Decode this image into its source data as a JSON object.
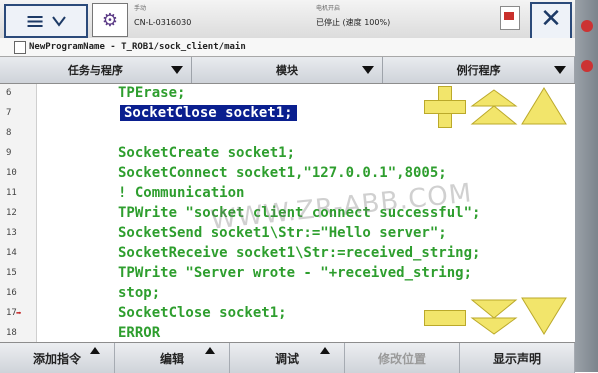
{
  "header": {
    "menu_icon": "hamburger-menu-icon",
    "robot_icon": "robot-status-icon",
    "mode_label": "手动",
    "controller_name": "CN-L-0316030",
    "motors_label": "电机开启",
    "status_text": "已停止 (速度 100%)",
    "close_icon": "close-icon"
  },
  "path": "NewProgramName - T_ROB1/sock_client/main",
  "tabs": [
    {
      "label": "任务与程序"
    },
    {
      "label": "模块"
    },
    {
      "label": "例行程序"
    }
  ],
  "code_lines": [
    {
      "num": "6",
      "text": "TPErase;"
    },
    {
      "num": "7",
      "text": "SocketClose socket1;"
    },
    {
      "num": "8",
      "text": ""
    },
    {
      "num": "9",
      "text": "SocketCreate socket1;"
    },
    {
      "num": "10",
      "text": "SocketConnect socket1,\"127.0.0.1\",8005;"
    },
    {
      "num": "11",
      "text": "! Communication"
    },
    {
      "num": "12",
      "text": "TPWrite \"socket client connect successful\";"
    },
    {
      "num": "13",
      "text": "SocketSend socket1\\Str:=\"Hello server\";"
    },
    {
      "num": "14",
      "text": "SocketReceive socket1\\Str:=received_string;"
    },
    {
      "num": "15",
      "text": "TPWrite \"Server wrote - \"+received_string;"
    },
    {
      "num": "16",
      "text": "stop;"
    },
    {
      "num": "17",
      "text": "SocketClose socket1;"
    },
    {
      "num": "18",
      "text": "ERROR"
    }
  ],
  "selected_line": "7",
  "watermark": "WWW.ZR-ABB.COM",
  "nav_icons": [
    "add-icon",
    "page-up-icon",
    "line-up-icon",
    "remove-icon",
    "page-down-icon",
    "line-down-icon"
  ],
  "bottom_buttons": [
    {
      "label": "添加指令",
      "enabled": true
    },
    {
      "label": "编辑",
      "enabled": true
    },
    {
      "label": "调试",
      "enabled": true
    },
    {
      "label": "修改位置",
      "enabled": false
    },
    {
      "label": "显示声明",
      "enabled": true
    }
  ],
  "colors": {
    "code": "#2e9e2e",
    "selection": "#0a1f8f",
    "nav_yellow": "#f2e56b"
  }
}
